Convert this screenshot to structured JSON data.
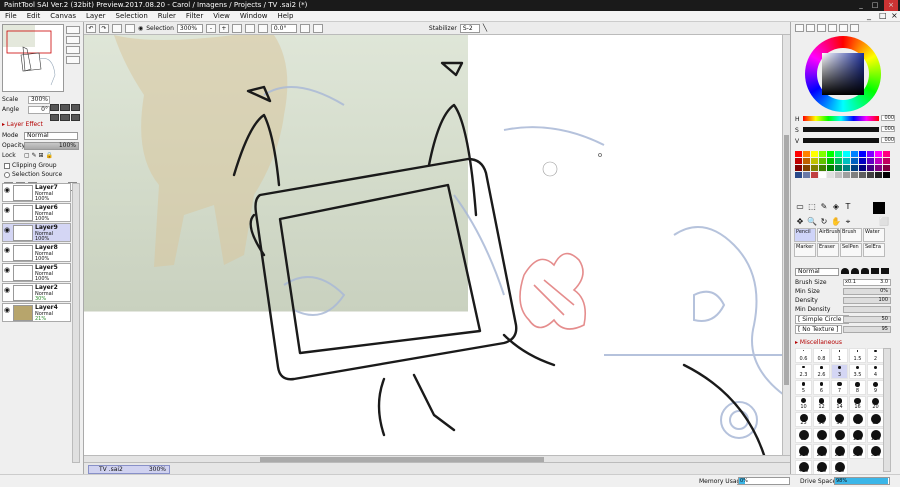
{
  "title": "PaintTool SAI Ver.2 (32bit) Preview.2017.08.20 - Carol / Imagens / Projects / TV .sai2 (*)",
  "window_controls": [
    "_",
    "□",
    "×"
  ],
  "menu": [
    "File",
    "Edit",
    "Canvas",
    "Layer",
    "Selection",
    "Ruler",
    "Filter",
    "View",
    "Window",
    "Help"
  ],
  "toolbar": {
    "selection_label": "Selection",
    "zoom": "300%",
    "angle": "0.0°",
    "stabilizer_label": "Stabilizer",
    "stabilizer_value": "S-2"
  },
  "navigator": {
    "scale_label": "Scale",
    "scale_value": "300%",
    "angle_label": "Angle",
    "angle_value": "0°"
  },
  "layer_panel": {
    "effect_label": "Layer Effect",
    "mode_label": "Mode",
    "mode_value": "Normal",
    "opacity_label": "Opacity",
    "opacity_value": "100%",
    "lock_label": "Lock",
    "clipping_label": "Clipping Group",
    "selection_source_label": "Selection Source",
    "layers": [
      {
        "name": "Layer7",
        "mode": "Normal",
        "opacity": "100%",
        "selected": false
      },
      {
        "name": "Layer6",
        "mode": "Normal",
        "opacity": "100%",
        "selected": false
      },
      {
        "name": "Layer9",
        "mode": "Normal",
        "opacity": "100%",
        "selected": true
      },
      {
        "name": "Layer8",
        "mode": "Normal",
        "opacity": "100%",
        "selected": false
      },
      {
        "name": "Layer5",
        "mode": "Normal",
        "opacity": "100%",
        "selected": false
      },
      {
        "name": "Layer2",
        "mode": "Normal",
        "opacity": "30%",
        "selected": false
      },
      {
        "name": "Layer4",
        "mode": "Normal",
        "opacity": "21%",
        "selected": false
      }
    ]
  },
  "color_panel": {
    "h_label": "H",
    "h_value": "000",
    "s_label": "S",
    "s_value": "000",
    "v_label": "V",
    "v_value": "000",
    "current_color": "#000000"
  },
  "swatch_colors": [
    "#ff0000",
    "#ff8000",
    "#ffff00",
    "#80ff00",
    "#00ff00",
    "#00ff80",
    "#00ffff",
    "#0080ff",
    "#0000ff",
    "#8000ff",
    "#ff00ff",
    "#ff0080",
    "#c00000",
    "#c06000",
    "#c0c000",
    "#60c000",
    "#00c000",
    "#00c060",
    "#00c0c0",
    "#0060c0",
    "#0000c0",
    "#6000c0",
    "#c000c0",
    "#c00060",
    "#800000",
    "#804000",
    "#808000",
    "#408000",
    "#008000",
    "#008040",
    "#008080",
    "#004080",
    "#000080",
    "#400080",
    "#800080",
    "#800040",
    "#2b4a8a",
    "#6a7aa8",
    "#c04040",
    "#ffffff",
    "#e0e0e0",
    "#c0c0c0",
    "#a0a0a0",
    "#808080",
    "#606060",
    "#404040",
    "#202020",
    "#000000"
  ],
  "tool_glyphs": [
    "▭",
    "⬚",
    "✎",
    "◈",
    "T",
    "✥",
    "🔍",
    "↻",
    "✋",
    "⌖",
    "◐",
    "⬜"
  ],
  "brushes": [
    {
      "name": "Pencil",
      "selected": true
    },
    {
      "name": "AirBrush",
      "selected": false
    },
    {
      "name": "Brush",
      "selected": false
    },
    {
      "name": "Water",
      "selected": false
    },
    {
      "name": "Marker",
      "selected": false
    },
    {
      "name": "Eraser",
      "selected": false
    },
    {
      "name": "SelPen",
      "selected": false
    },
    {
      "name": "SelEra",
      "selected": false
    }
  ],
  "brush_props": {
    "blend_mode": "Normal",
    "brush_size_label": "Brush Size",
    "brush_size_mult": "x0.1",
    "brush_size_value": "3.0",
    "min_size_label": "Min Size",
    "min_size_value": "0%",
    "density_label": "Density",
    "density_value": "100",
    "min_density_label": "Min Density",
    "shape": "[ Simple Circle ]",
    "shape_value": "50",
    "texture": "[ No Texture ]",
    "texture_value": "95",
    "misc_label": "Miscellaneous"
  },
  "brush_sizes": [
    "0.6",
    "0.8",
    "1",
    "1.5",
    "2",
    "2.3",
    "2.6",
    "3",
    "3.5",
    "4",
    "5",
    "6",
    "7",
    "8",
    "9",
    "10",
    "12",
    "14",
    "16",
    "20",
    "25",
    "30",
    "35",
    "40",
    "50",
    "60",
    "70",
    "80",
    "100",
    "120",
    "160",
    "200",
    "250",
    "300",
    "350",
    "400",
    "450",
    "500"
  ],
  "tab": {
    "name": "TV .sai2",
    "zoom": "300%"
  },
  "status": {
    "memory_label": "Memory Usage",
    "memory_value": "0%",
    "memory_fraction": 0.08,
    "drive_label": "Drive Space",
    "drive_value": "98%",
    "drive_fraction": 0.98
  }
}
